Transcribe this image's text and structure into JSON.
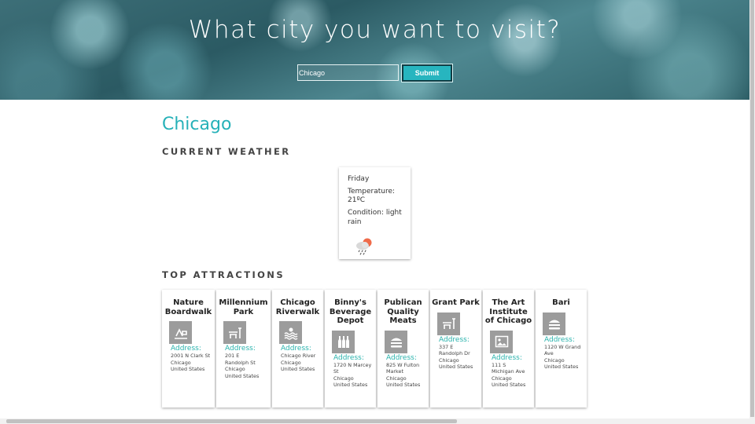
{
  "hero": {
    "title": "What city you want to visit?",
    "search_value": "Chicago",
    "submit_label": "Submit"
  },
  "city": "Chicago",
  "sections": {
    "weather_heading": "CURRENT WEATHER",
    "attractions_heading": "TOP ATTRACTIONS"
  },
  "weather": {
    "day": "Friday",
    "temperature": "Temperature: 21ºC",
    "condition": "Condition: light rain",
    "icon": "light-rain-icon"
  },
  "attractions": [
    {
      "name": "Nature Boardwalk",
      "icon": "park-icon",
      "address_label": "Address:",
      "address": [
        "2001 N Clark St",
        "Chicago",
        "United States"
      ]
    },
    {
      "name": "Millennium Park",
      "icon": "bench-icon",
      "address_label": "Address:",
      "address": [
        "201 E Randolph St",
        "Chicago",
        "United States"
      ]
    },
    {
      "name": "Chicago Riverwalk",
      "icon": "water-icon",
      "address_label": "Address:",
      "address": [
        "Chicago River",
        "Chicago",
        "United States"
      ]
    },
    {
      "name": "Binny's Beverage Depot",
      "icon": "bottles-icon",
      "address_label": "Address:",
      "address": [
        "1720 N Marcey St",
        "Chicago",
        "United States"
      ]
    },
    {
      "name": "Publican Quality Meats",
      "icon": "burger-icon",
      "address_label": "Address:",
      "address": [
        "825 W Fulton Market",
        "Chicago",
        "United States"
      ]
    },
    {
      "name": "Grant Park",
      "icon": "bench-icon",
      "address_label": "Address:",
      "address": [
        "337 E Randolph Dr",
        "Chicago",
        "United States"
      ]
    },
    {
      "name": "The Art Institute of Chicago",
      "icon": "picture-icon",
      "address_label": "Address:",
      "address": [
        "111 S Michigan Ave",
        "Chicago",
        "United States"
      ]
    },
    {
      "name": "Bari",
      "icon": "burger-icon",
      "address_label": "Address:",
      "address": [
        "1120 W Grand Ave",
        "Chicago",
        "United States"
      ]
    }
  ]
}
